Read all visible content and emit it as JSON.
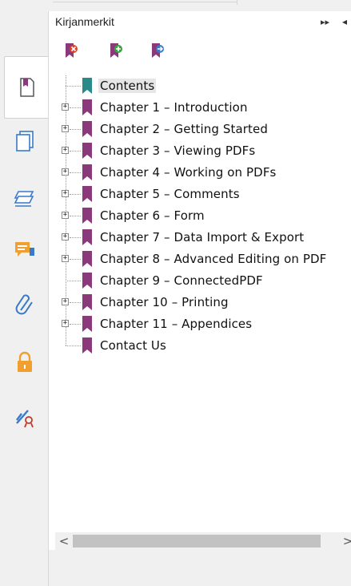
{
  "panel": {
    "title": "Kirjanmerkit",
    "collapse_glyph": "⏩",
    "extra_glyph": "◂"
  },
  "toolbar": {
    "buttons": [
      {
        "name": "delete-bookmark",
        "icon": "bookmark-delete-icon"
      },
      {
        "name": "add-bookmark",
        "icon": "bookmark-add-icon"
      },
      {
        "name": "go-bookmark",
        "icon": "bookmark-goto-icon"
      }
    ]
  },
  "rail": {
    "items": [
      {
        "name": "bookmarks-tab",
        "icon": "bookmark-page-icon",
        "active": true
      },
      {
        "name": "pages-tab",
        "icon": "pages-icon"
      },
      {
        "name": "layers-tab",
        "icon": "layers-icon"
      },
      {
        "name": "comments-tab",
        "icon": "comments-icon"
      },
      {
        "name": "attachments-tab",
        "icon": "paperclip-icon"
      },
      {
        "name": "security-tab",
        "icon": "lock-icon"
      },
      {
        "name": "signatures-tab",
        "icon": "signature-icon"
      }
    ]
  },
  "bookmarks": [
    {
      "label": "Contents",
      "expandable": false,
      "selected": true,
      "color": "#2a8a8a"
    },
    {
      "label": "Chapter 1 – Introduction",
      "expandable": true,
      "color": "#8a3a7a"
    },
    {
      "label": "Chapter 2 – Getting Started",
      "expandable": true,
      "color": "#8a3a7a"
    },
    {
      "label": "Chapter 3 – Viewing PDFs",
      "expandable": true,
      "color": "#8a3a7a"
    },
    {
      "label": "Chapter 4 – Working on PDFs",
      "expandable": true,
      "color": "#8a3a7a"
    },
    {
      "label": "Chapter 5 – Comments",
      "expandable": true,
      "color": "#8a3a7a"
    },
    {
      "label": "Chapter 6 – Form",
      "expandable": true,
      "color": "#8a3a7a"
    },
    {
      "label": "Chapter 7 – Data Import & Export",
      "expandable": true,
      "color": "#8a3a7a"
    },
    {
      "label": "Chapter 8 – Advanced Editing on PDF",
      "expandable": true,
      "color": "#8a3a7a"
    },
    {
      "label": "Chapter 9 – ConnectedPDF",
      "expandable": false,
      "color": "#8a3a7a"
    },
    {
      "label": "Chapter 10 – Printing",
      "expandable": true,
      "color": "#8a3a7a"
    },
    {
      "label": "Chapter 11 – Appendices",
      "expandable": true,
      "color": "#8a3a7a"
    },
    {
      "label": "Contact Us",
      "expandable": false,
      "color": "#8a3a7a"
    }
  ],
  "scrollbar": {
    "left_glyph": "<",
    "right_glyph": ">"
  },
  "colors": {
    "accent_bookmark": "#8a3a7a",
    "contents_bookmark": "#2a8a8a",
    "icon_blue": "#3a7ac8",
    "icon_orange": "#f0a030"
  }
}
